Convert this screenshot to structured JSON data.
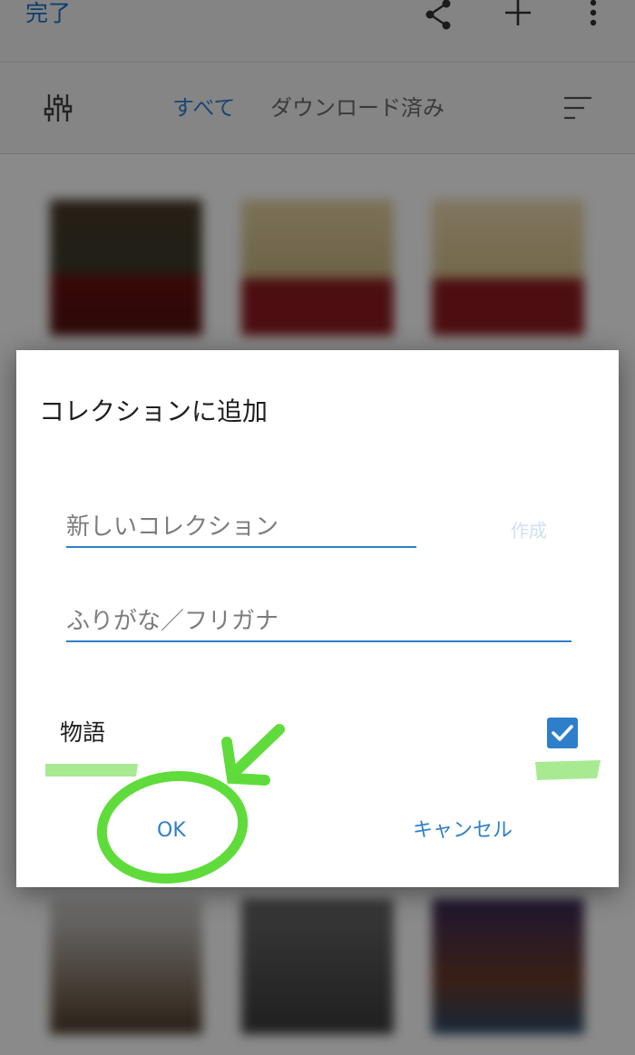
{
  "topbar": {
    "done_label": "完了",
    "icons": [
      "share-icon",
      "plus-icon",
      "more-vertical-icon"
    ]
  },
  "filterbar": {
    "tabs": [
      {
        "label": "すべて",
        "active": true
      },
      {
        "label": "ダウンロード済み",
        "active": false
      }
    ],
    "icons": [
      "sliders-icon",
      "sort-icon"
    ]
  },
  "dialog": {
    "title": "コレクションに追加",
    "new_collection": {
      "placeholder": "新しいコレクション",
      "value": ""
    },
    "create_label": "作成",
    "furigana": {
      "placeholder": "ふりがな／フリガナ",
      "value": ""
    },
    "collection_item": {
      "label": "物語",
      "checked": true
    },
    "ok_label": "OK",
    "cancel_label": "キャンセル"
  },
  "colors": {
    "accent": "#2f7fc8",
    "highlight": "#8be36d",
    "annotation": "#5fdc3b"
  }
}
